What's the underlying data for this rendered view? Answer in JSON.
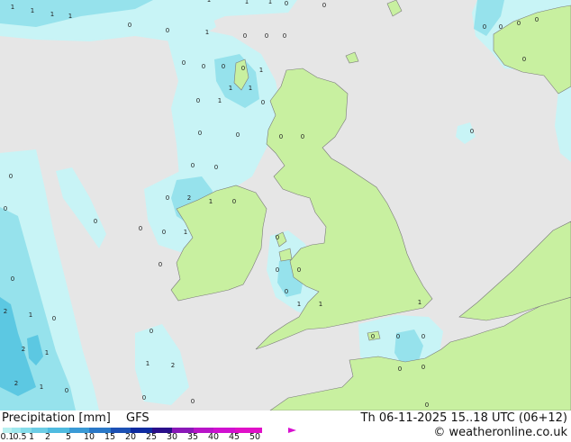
{
  "legend": {
    "title": "Precipitation [mm]",
    "model": "GFS",
    "datetime": "Th 06-11-2025 15..18 UTC (06+12)",
    "site": "© weatheronline.co.uk",
    "scale_labels": [
      "0.1",
      "0.5",
      "1",
      "2",
      "5",
      "10",
      "15",
      "20",
      "25",
      "30",
      "35",
      "40",
      "45",
      "50"
    ],
    "scale_colors": [
      "#b8f0f0",
      "#9ee8ee",
      "#84dcea",
      "#6ccde6",
      "#4fbbe0",
      "#3a9ad6",
      "#2a78c8",
      "#1c50b4",
      "#0e2aa0",
      "#2a0e8a",
      "#8a18b8",
      "#b814c8",
      "#d010d0",
      "#e010c8"
    ]
  },
  "map": {
    "colors": {
      "sea": "#e6e6e6",
      "land": "#c8f0a0",
      "precip_light": "#c8f4f6",
      "precip_medium": "#96e2ec",
      "precip_heavy": "#5cc8e2",
      "border": "#7a7a7a"
    },
    "point_values": [
      "1",
      "1",
      "1",
      "1",
      "1",
      "1",
      "1",
      "0",
      "0",
      "0",
      "0",
      "1",
      "0",
      "0",
      "0",
      "0",
      "0",
      "0",
      "0",
      "1",
      "1",
      "1",
      "1",
      "0",
      "0",
      "0",
      "0",
      "0",
      "0",
      "0",
      "0",
      "0",
      "0",
      "0",
      "0",
      "0",
      "0",
      "0",
      "2",
      "1",
      "0",
      "0",
      "1",
      "0",
      "0",
      "0",
      "0",
      "1",
      "1",
      "1",
      "0",
      "0",
      "0",
      "0",
      "0",
      "0",
      "0",
      "1",
      "2",
      "2",
      "1",
      "0",
      "2",
      "1",
      "2",
      "1",
      "0",
      "0",
      "0",
      "0",
      "0",
      "0",
      "0",
      "0",
      "0"
    ]
  }
}
